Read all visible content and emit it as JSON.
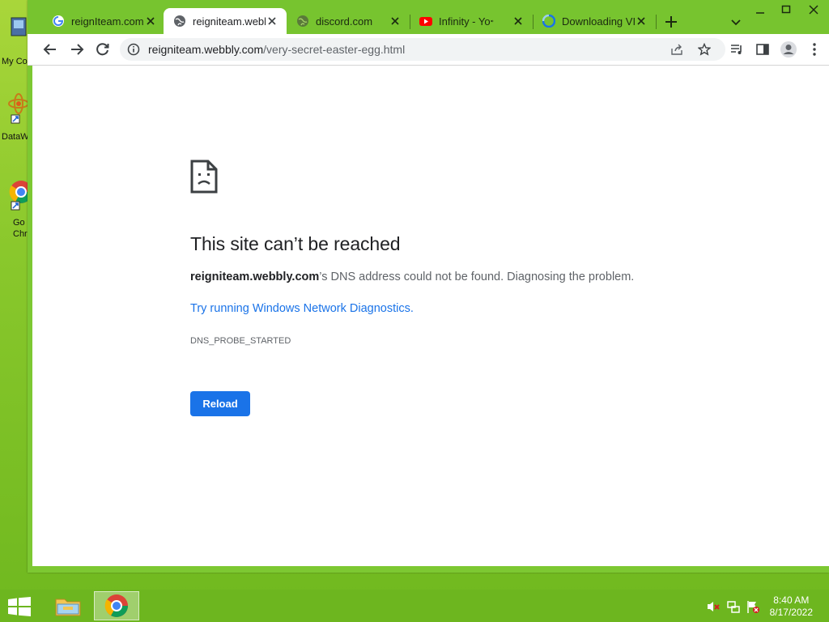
{
  "desktop": {
    "icons": [
      {
        "label": "My Co"
      },
      {
        "label": "DataW"
      },
      {
        "label": "Go\nChr"
      }
    ]
  },
  "browser": {
    "tabs": [
      {
        "title": "reignIteam.com",
        "active": false
      },
      {
        "title": "reigniteam.webb",
        "active": true
      },
      {
        "title": "discord.com",
        "active": false
      },
      {
        "title": "Infinity - Yo",
        "active": false
      },
      {
        "title": "Downloading VI",
        "active": false
      }
    ],
    "address": {
      "host": "reigniteam.webbly.com",
      "path": "/very-secret-easter-egg.html"
    }
  },
  "error_page": {
    "title": "This site can’t be reached",
    "host_bold": "reigniteam.webbly.com",
    "desc_rest": "’s DNS address could not be found. Diagnosing the problem.",
    "link": "Try running Windows Network Diagnostics.",
    "code": "DNS_PROBE_STARTED",
    "reload_label": "Reload"
  },
  "taskbar": {
    "time": "8:40 AM",
    "date": "8/17/2022"
  },
  "colors": {
    "accent": "#1a73e8",
    "desktop_green": "#8ac82c",
    "youtube_red": "#ff0000"
  }
}
